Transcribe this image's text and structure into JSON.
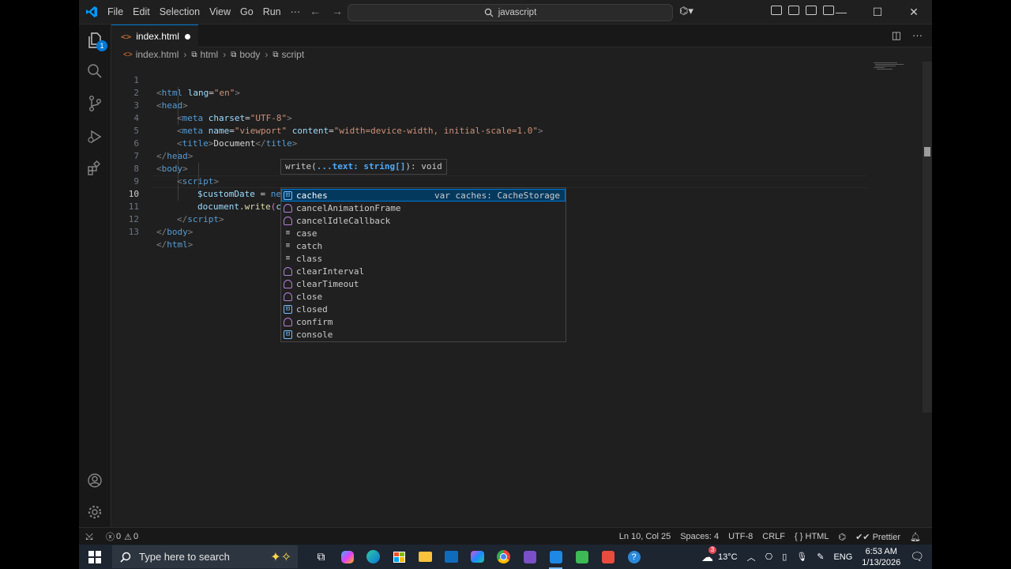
{
  "titlebar": {
    "menu": [
      "File",
      "Edit",
      "Selection",
      "View",
      "Go",
      "Run",
      "···"
    ],
    "search": "javascript"
  },
  "activity": {
    "explorer_badge": "1"
  },
  "tab": {
    "filename": "index.html",
    "icon_text": "<>"
  },
  "breadcrumb": [
    "index.html",
    "html",
    "body",
    "script"
  ],
  "line_numbers": [
    "1",
    "2",
    "3",
    "4",
    "5",
    "6",
    "7",
    "8",
    "9",
    "10",
    "11",
    "12",
    "13"
  ],
  "code": {
    "l1": {
      "t1": "<",
      "tag": "html",
      "attr": "lang",
      "eq": "=",
      "val": "\"en\"",
      "t2": ">"
    },
    "l2": {
      "t1": "<",
      "tag": "head",
      "t2": ">"
    },
    "l3": {
      "t1": "<",
      "tag": "meta",
      "attr": "charset",
      "eq": "=",
      "val": "\"UTF-8\"",
      "t2": ">"
    },
    "l4": {
      "t1": "<",
      "tag": "meta",
      "attr1": "name",
      "eq": "=",
      "val1": "\"viewport\"",
      "attr2": "content",
      "val2": "\"width=device-width, initial-scale=1.0\"",
      "t2": ">"
    },
    "l5": {
      "t1": "<",
      "tag": "title",
      "t2": ">",
      "text": "Document",
      "t3": "</",
      "t4": ">"
    },
    "l6": {
      "t1": "</",
      "tag": "head",
      "t2": ">"
    },
    "l7": {
      "t1": "<",
      "tag": "body",
      "t2": ">"
    },
    "l8": {
      "t1": "<",
      "tag": "script",
      "t2": ">"
    },
    "l9": {
      "var": "$customDate",
      "op": " = ",
      "kw": "ne"
    },
    "l10": {
      "obj": "document",
      "dot": ".",
      "fn": "write",
      "open": "(",
      "arg": "c",
      "close": ")"
    },
    "l11": {
      "t1": "</",
      "tag": "script",
      "t2": ">"
    },
    "l12": {
      "t1": "</",
      "tag": "body",
      "t2": ">"
    },
    "l13": {
      "t1": "</",
      "tag": "html",
      "t2": ">"
    }
  },
  "signature_help": {
    "pre": "write(",
    "param": "...text: string[]",
    "post": "): void"
  },
  "suggestions": [
    {
      "label": "caches",
      "kind": "var",
      "detail": "var caches: CacheStorage"
    },
    {
      "label": "cancelAnimationFrame",
      "kind": "fun"
    },
    {
      "label": "cancelIdleCallback",
      "kind": "fun"
    },
    {
      "label": "case",
      "kind": "kw"
    },
    {
      "label": "catch",
      "kind": "kw"
    },
    {
      "label": "class",
      "kind": "kw"
    },
    {
      "label": "clearInterval",
      "kind": "fun"
    },
    {
      "label": "clearTimeout",
      "kind": "fun"
    },
    {
      "label": "close",
      "kind": "fun"
    },
    {
      "label": "closed",
      "kind": "var"
    },
    {
      "label": "confirm",
      "kind": "fun"
    },
    {
      "label": "console",
      "kind": "var"
    }
  ],
  "status": {
    "errors": "0",
    "warnings": "0",
    "position": "Ln 10, Col 25",
    "spaces": "Spaces: 4",
    "encoding": "UTF-8",
    "eol": "CRLF",
    "language": "HTML",
    "prettier": "Prettier"
  },
  "taskbar": {
    "search_placeholder": "Type here to search",
    "weather": "13°C",
    "weather_badge": "3",
    "language": "ENG",
    "time": "6:53 AM",
    "date": "1/13/2026"
  },
  "colors": {
    "accent": "#0078d4",
    "editor_bg": "#1f1f1f",
    "selection": "#04395e"
  }
}
